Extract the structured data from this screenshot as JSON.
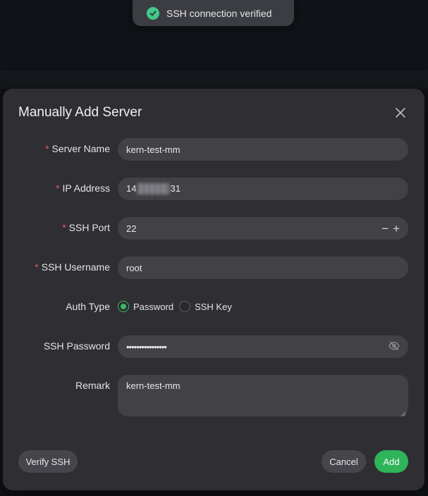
{
  "toast": {
    "message": "SSH connection verified",
    "icon": "check-circle-icon",
    "color": "#41c98b"
  },
  "modal": {
    "title": "Manually Add Server",
    "close_icon": "close-icon"
  },
  "form": {
    "server_name": {
      "label": "Server Name",
      "required": "*",
      "value": "kern-test-mm"
    },
    "ip_address": {
      "label": "IP Address",
      "required": "*",
      "value_prefix": "14",
      "value_suffix": "31"
    },
    "ssh_port": {
      "label": "SSH Port",
      "required": "*",
      "value": "22",
      "decrement": "−",
      "increment": "+"
    },
    "ssh_username": {
      "label": "SSH Username",
      "required": "*",
      "value": "root"
    },
    "auth_type": {
      "label": "Auth Type",
      "options": [
        {
          "label": "Password",
          "selected": true
        },
        {
          "label": "SSH Key",
          "selected": false
        }
      ]
    },
    "ssh_password": {
      "label": "SSH Password",
      "value": "••••••••••••••••",
      "toggle_icon": "eye-off-icon"
    },
    "remark": {
      "label": "Remark",
      "value": "kern-test-mm"
    }
  },
  "footer": {
    "verify_label": "Verify SSH",
    "cancel_label": "Cancel",
    "add_label": "Add"
  },
  "colors": {
    "accent": "#2fb45a",
    "required": "#e45b5b",
    "modal_bg": "#2f2f33",
    "input_bg": "#414146"
  }
}
